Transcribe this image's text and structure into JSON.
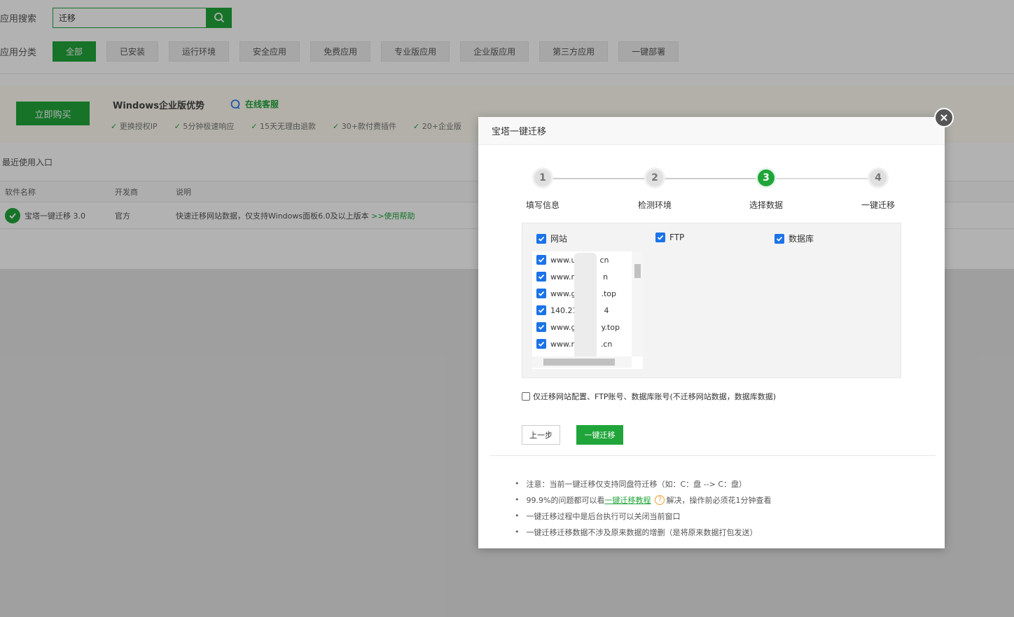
{
  "search": {
    "label": "应用搜索",
    "value": "迁移"
  },
  "category": {
    "label": "应用分类",
    "items": [
      "全部",
      "已安装",
      "运行环境",
      "安全应用",
      "免费应用",
      "专业版应用",
      "企业版应用",
      "第三方应用",
      "一键部署"
    ]
  },
  "promo": {
    "buy_label": "立即购买",
    "title": "Windows企业版优势",
    "service": "在线客服",
    "features": [
      "更换授权IP",
      "5分钟极速响应",
      "15天无理由退款",
      "30+款付费插件",
      "20+企业版"
    ]
  },
  "recent": {
    "label": "最近使用入口"
  },
  "table": {
    "headers": [
      "软件名称",
      "开发商",
      "说明"
    ],
    "row": {
      "name": "宝塔一键迁移 3.0",
      "developer": "官方",
      "desc": "快速迁移网站数据，仅支持Windows面板6.0及以上版本",
      "help": ">>使用帮助"
    }
  },
  "modal": {
    "title": "宝塔一键迁移",
    "steps": [
      {
        "num": "1",
        "label": "填写信息"
      },
      {
        "num": "2",
        "label": "检测环境"
      },
      {
        "num": "3",
        "label": "选择数据"
      },
      {
        "num": "4",
        "label": "一键迁移"
      }
    ],
    "active_step": 3,
    "types": [
      "网站",
      "FTP",
      "数据库"
    ],
    "sites": [
      "www.u",
      "cn",
      "www.ri",
      "n",
      "www.g",
      ".top",
      "140.21",
      "4",
      "www.g",
      "y.top",
      "www.rc",
      ".cn"
    ],
    "only_config": "仅迁移网站配置、FTP账号、数据库账号(不迁移网站数据，数据库数据)",
    "prev_label": "上一步",
    "go_label": "一键迁移",
    "notes": {
      "n1": "注意：当前一键迁移仅支持同盘符迁移（如：C：盘 --> C：盘）",
      "n2_pre": "99.9%的问题都可以看",
      "n2_link": "一键迁移教程",
      "n2_post": "解决，操作前必须花1分钟查看",
      "n3": "一键迁移过程中是后台执行可以关闭当前窗口",
      "n4": "一键迁移迁移数据不涉及原来数据的增删（是将原来数据打包发送）"
    }
  },
  "colors": {
    "accent": "#20a53a",
    "checkbox": "#1a73e8"
  }
}
